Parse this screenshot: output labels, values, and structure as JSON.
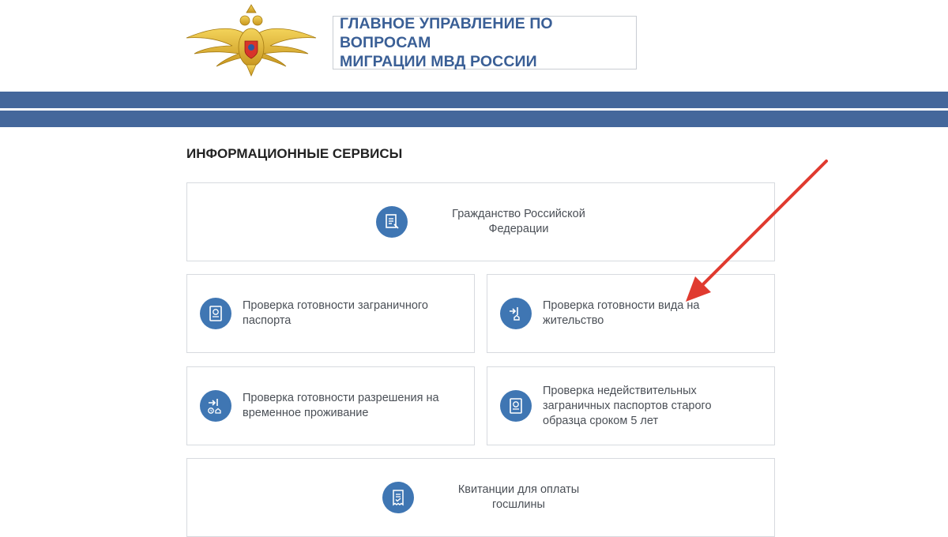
{
  "header": {
    "title": "ГЛАВНОЕ УПРАВЛЕНИЕ ПО ВОПРОСАМ\nМИГРАЦИИ МВД РОССИИ"
  },
  "section": {
    "title": "ИНФОРМАЦИОННЫЕ СЕРВИСЫ"
  },
  "services": [
    {
      "label": "Гражданство Российской\nФедерации",
      "icon": "citizenship-document-icon"
    },
    {
      "label": "Проверка готовности заграничного\nпаспорта",
      "icon": "passport-icon"
    },
    {
      "label": "Проверка готовности вида на\nжительство",
      "icon": "residence-permit-icon"
    },
    {
      "label": "Проверка готовности разрешения на\nвременное проживание",
      "icon": "temporary-residence-icon"
    },
    {
      "label": "Проверка недействительных\nзаграничных паспортов старого\nобразца сроком 5 лет",
      "icon": "invalid-passport-icon"
    },
    {
      "label": "Квитанции для оплаты\nгосшлины",
      "icon": "receipt-icon"
    }
  ],
  "colors": {
    "brand_blue": "#44679b",
    "title_blue": "#3a5f96",
    "icon_blue": "#3f76b3",
    "annotation_red": "#e03a2f"
  }
}
